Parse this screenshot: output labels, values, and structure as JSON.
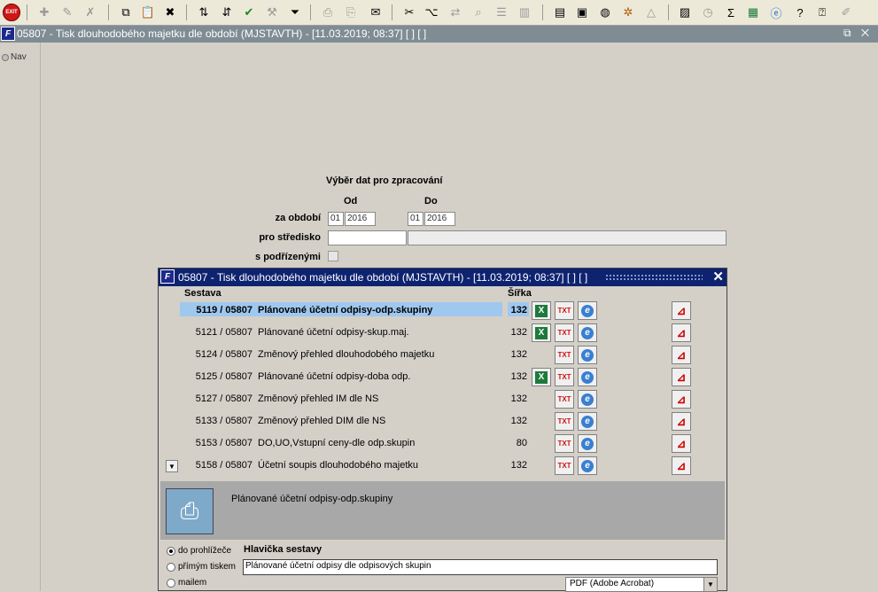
{
  "toolbar": {
    "exit_label": "EXIT"
  },
  "outer_window": {
    "app_icon": "F",
    "title": "05807 - Tisk dlouhodobého majetku dle období (MJSTAVTH) - [11.03.2019; 08:37]  [ ]  [ ]",
    "controls": "⧉ ✕"
  },
  "nav": {
    "label": "Nav"
  },
  "selection": {
    "heading": "Výběr dat pro zpracování",
    "col_from": "Od",
    "col_to": "Do",
    "period_label": "za období",
    "period_from_month": "01",
    "period_from_year": "2016",
    "period_to_month": "01",
    "period_to_year": "2016",
    "center_label": "pro středisko",
    "center_value": "",
    "center_name": "",
    "subordinates_label": "s podřízenými",
    "subordinates_checked": false
  },
  "dialog": {
    "app_icon": "F",
    "title": "05807 - Tisk dlouhodobého majetku dle období (MJSTAVTH) - [11.03.2019; 08:37]  [ ]  [ ]",
    "close": "✕",
    "header_report": "Sestava",
    "header_width": "Šířka",
    "rows": [
      {
        "code": "5119 / 05807",
        "name": "Plánované účetní odpisy-odp.skupiny",
        "width": "132",
        "xls": true,
        "selected": true
      },
      {
        "code": "5121 / 05807",
        "name": "Plánované účetní odpisy-skup.maj.",
        "width": "132",
        "xls": true
      },
      {
        "code": "5124 / 05807",
        "name": "Změnový přehled dlouhodobého majetku",
        "width": "132",
        "xls": false
      },
      {
        "code": "5125 / 05807",
        "name": "Plánované účetní odpisy-doba odp.",
        "width": "132",
        "xls": true
      },
      {
        "code": "5127 / 05807",
        "name": "Změnový přehled IM dle NS",
        "width": "132",
        "xls": false
      },
      {
        "code": "5133 / 05807",
        "name": "Změnový přehled DIM dle NS",
        "width": "132",
        "xls": false
      },
      {
        "code": "5153 / 05807",
        "name": "DO,UO,Vstupní ceny-dle odp.skupin",
        "width": "80",
        "xls": false
      },
      {
        "code": "5158 / 05807",
        "name": "Účetní soupis dlouhodobého majetku",
        "width": "132",
        "xls": false
      }
    ],
    "icon_labels": {
      "xls": "X",
      "txt": "TXT",
      "ie": "e",
      "pdf": "⊿"
    },
    "description": "Plánované účetní odpisy-odp.skupiny",
    "output": {
      "opt_browser": "do prohlížeče",
      "opt_print": "přímým tiskem",
      "opt_mail": "mailem",
      "selected": "do prohlížeče",
      "header_label": "Hlavička sestavy",
      "header_value": "Plánované účetní odpisy dle odpisových skupin",
      "format": "PDF (Adobe Acrobat)"
    }
  }
}
